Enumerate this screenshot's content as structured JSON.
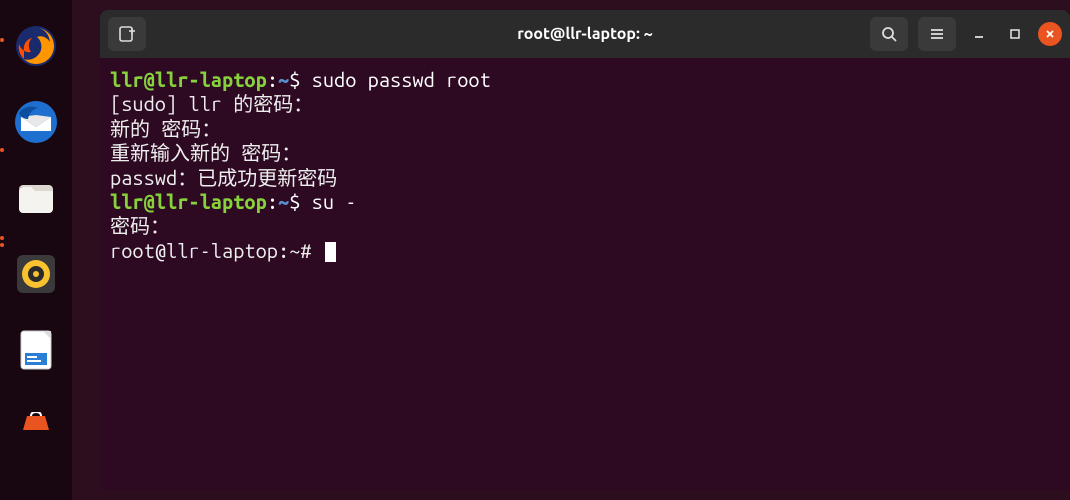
{
  "window": {
    "title": "root@llr-laptop: ~"
  },
  "terminal": {
    "lines": [
      {
        "type": "prompt",
        "user": "llr@llr-laptop",
        "path": "~",
        "symbol": "$",
        "command": "sudo   passwd  root"
      },
      {
        "type": "output",
        "text": "[sudo] llr 的密码："
      },
      {
        "type": "output",
        "text": "新的 密码："
      },
      {
        "type": "output",
        "text": "重新输入新的 密码："
      },
      {
        "type": "output",
        "text": "passwd：已成功更新密码"
      },
      {
        "type": "prompt",
        "user": "llr@llr-laptop",
        "path": "~",
        "symbol": "$",
        "command": "su -"
      },
      {
        "type": "output",
        "text": "密码："
      },
      {
        "type": "rootprompt",
        "text": "root@llr-laptop:~# ",
        "cursor": true
      }
    ]
  },
  "dock": {
    "items": [
      "firefox",
      "thunderbird",
      "files",
      "rhythmbox",
      "libreoffice-writer",
      "software"
    ]
  }
}
